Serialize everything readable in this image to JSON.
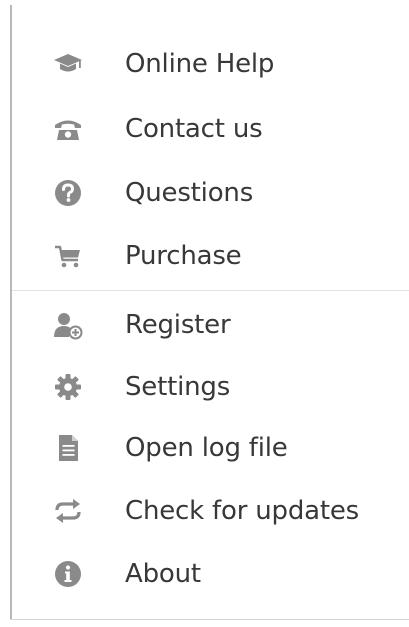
{
  "menu": {
    "items": [
      {
        "id": "online-help",
        "label": "Online Help",
        "icon": "graduation-cap-icon"
      },
      {
        "id": "contact-us",
        "label": "Contact us",
        "icon": "phone-icon"
      },
      {
        "id": "questions",
        "label": "Questions",
        "icon": "question-circle-icon"
      },
      {
        "id": "purchase",
        "label": "Purchase",
        "icon": "shopping-cart-icon"
      },
      {
        "id": "register",
        "label": "Register",
        "icon": "user-add-icon"
      },
      {
        "id": "settings",
        "label": "Settings",
        "icon": "gear-icon"
      },
      {
        "id": "open-log-file",
        "label": "Open log file",
        "icon": "document-icon"
      },
      {
        "id": "check-for-updates",
        "label": "Check for updates",
        "icon": "refresh-icon"
      },
      {
        "id": "about",
        "label": "About",
        "icon": "info-circle-icon"
      }
    ]
  },
  "colors": {
    "icon": "#8a8a8a",
    "text": "#383838",
    "divider": "#e3e3e3",
    "border": "#b8b8b8"
  }
}
